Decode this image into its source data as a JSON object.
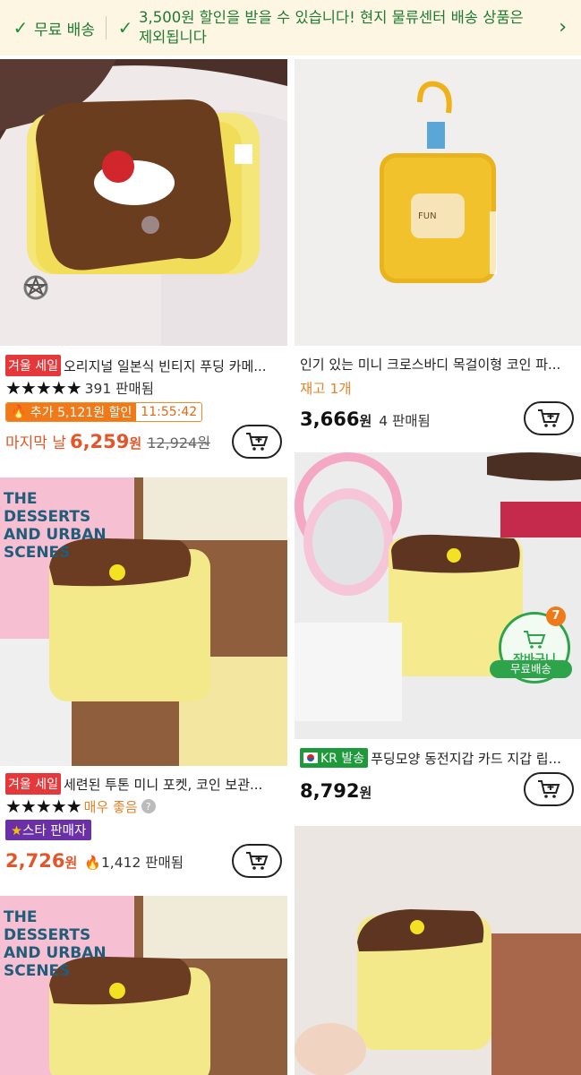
{
  "banner": {
    "free_shipping": "무료 배송",
    "message": "3,500원 할인을 받을 수 있습니다! 현지 물류센터 배송 상품은 제외됩니다"
  },
  "products": [
    {
      "badge": "겨울 세일",
      "title": "오리지널 일본식 빈티지 푸딩 카메...",
      "sold": "391 판매됨",
      "extra_label": "추가 5,121원 할인",
      "timer": "11:55:42",
      "price_prefix": "마지막 날",
      "price": "6,259",
      "won": "원",
      "original_price": "12,924원"
    },
    {
      "title": "인기 있는 미니 크로스바디 목걸이형 코인 파...",
      "stock": "재고 1개",
      "price": "3,666",
      "won": "원",
      "sold": "4 판매됨"
    },
    {
      "badge": "겨울 세일",
      "title": "세련된 투톤 미니 포켓, 코인 보관...",
      "rating_text": "매우 좋음",
      "star_seller": "스타 판매자",
      "price": "2,726",
      "won": "원",
      "sold": "1,412 판매됨"
    },
    {
      "ship_badge": "KR 발송",
      "title": "푸딩모양 동전지갑 카드 지갑 립...",
      "price": "8,792",
      "won": "원",
      "cart_count": "7",
      "cart_label": "장바구니",
      "free_ship": "무료배송"
    }
  ],
  "book_text": "THE DESSERTS AND URBAN SCENES"
}
